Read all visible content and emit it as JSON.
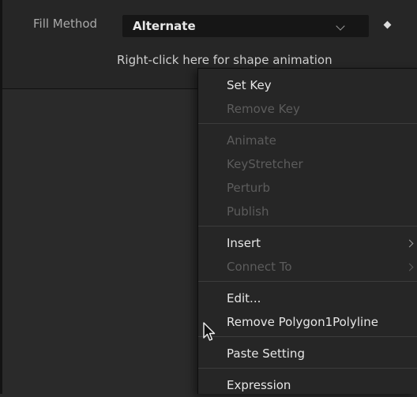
{
  "inspector": {
    "fill_method_label": "Fill Method",
    "fill_method_value": "Alternate",
    "shape_animation_hint": "Right-click here for shape animation"
  },
  "context_menu": {
    "items": [
      {
        "label": "Set Key",
        "enabled": true
      },
      {
        "label": "Remove Key",
        "enabled": false
      },
      {
        "label": "Animate",
        "enabled": false
      },
      {
        "label": "KeyStretcher",
        "enabled": false
      },
      {
        "label": "Perturb",
        "enabled": false
      },
      {
        "label": "Publish",
        "enabled": false
      },
      {
        "label": "Insert",
        "enabled": true,
        "submenu": true
      },
      {
        "label": "Connect To",
        "enabled": false,
        "submenu": true
      },
      {
        "label": "Edit...",
        "enabled": true
      },
      {
        "label": "Remove Polygon1Polyline",
        "enabled": true,
        "hovered": true
      },
      {
        "label": "Paste Setting",
        "enabled": true
      },
      {
        "label": "Expression",
        "enabled": true
      }
    ]
  },
  "colors": {
    "panel_bg": "#262626",
    "menu_text": "#e6e6e6",
    "menu_text_disabled": "#5c5c5c",
    "separator": "#3c3c3c"
  }
}
